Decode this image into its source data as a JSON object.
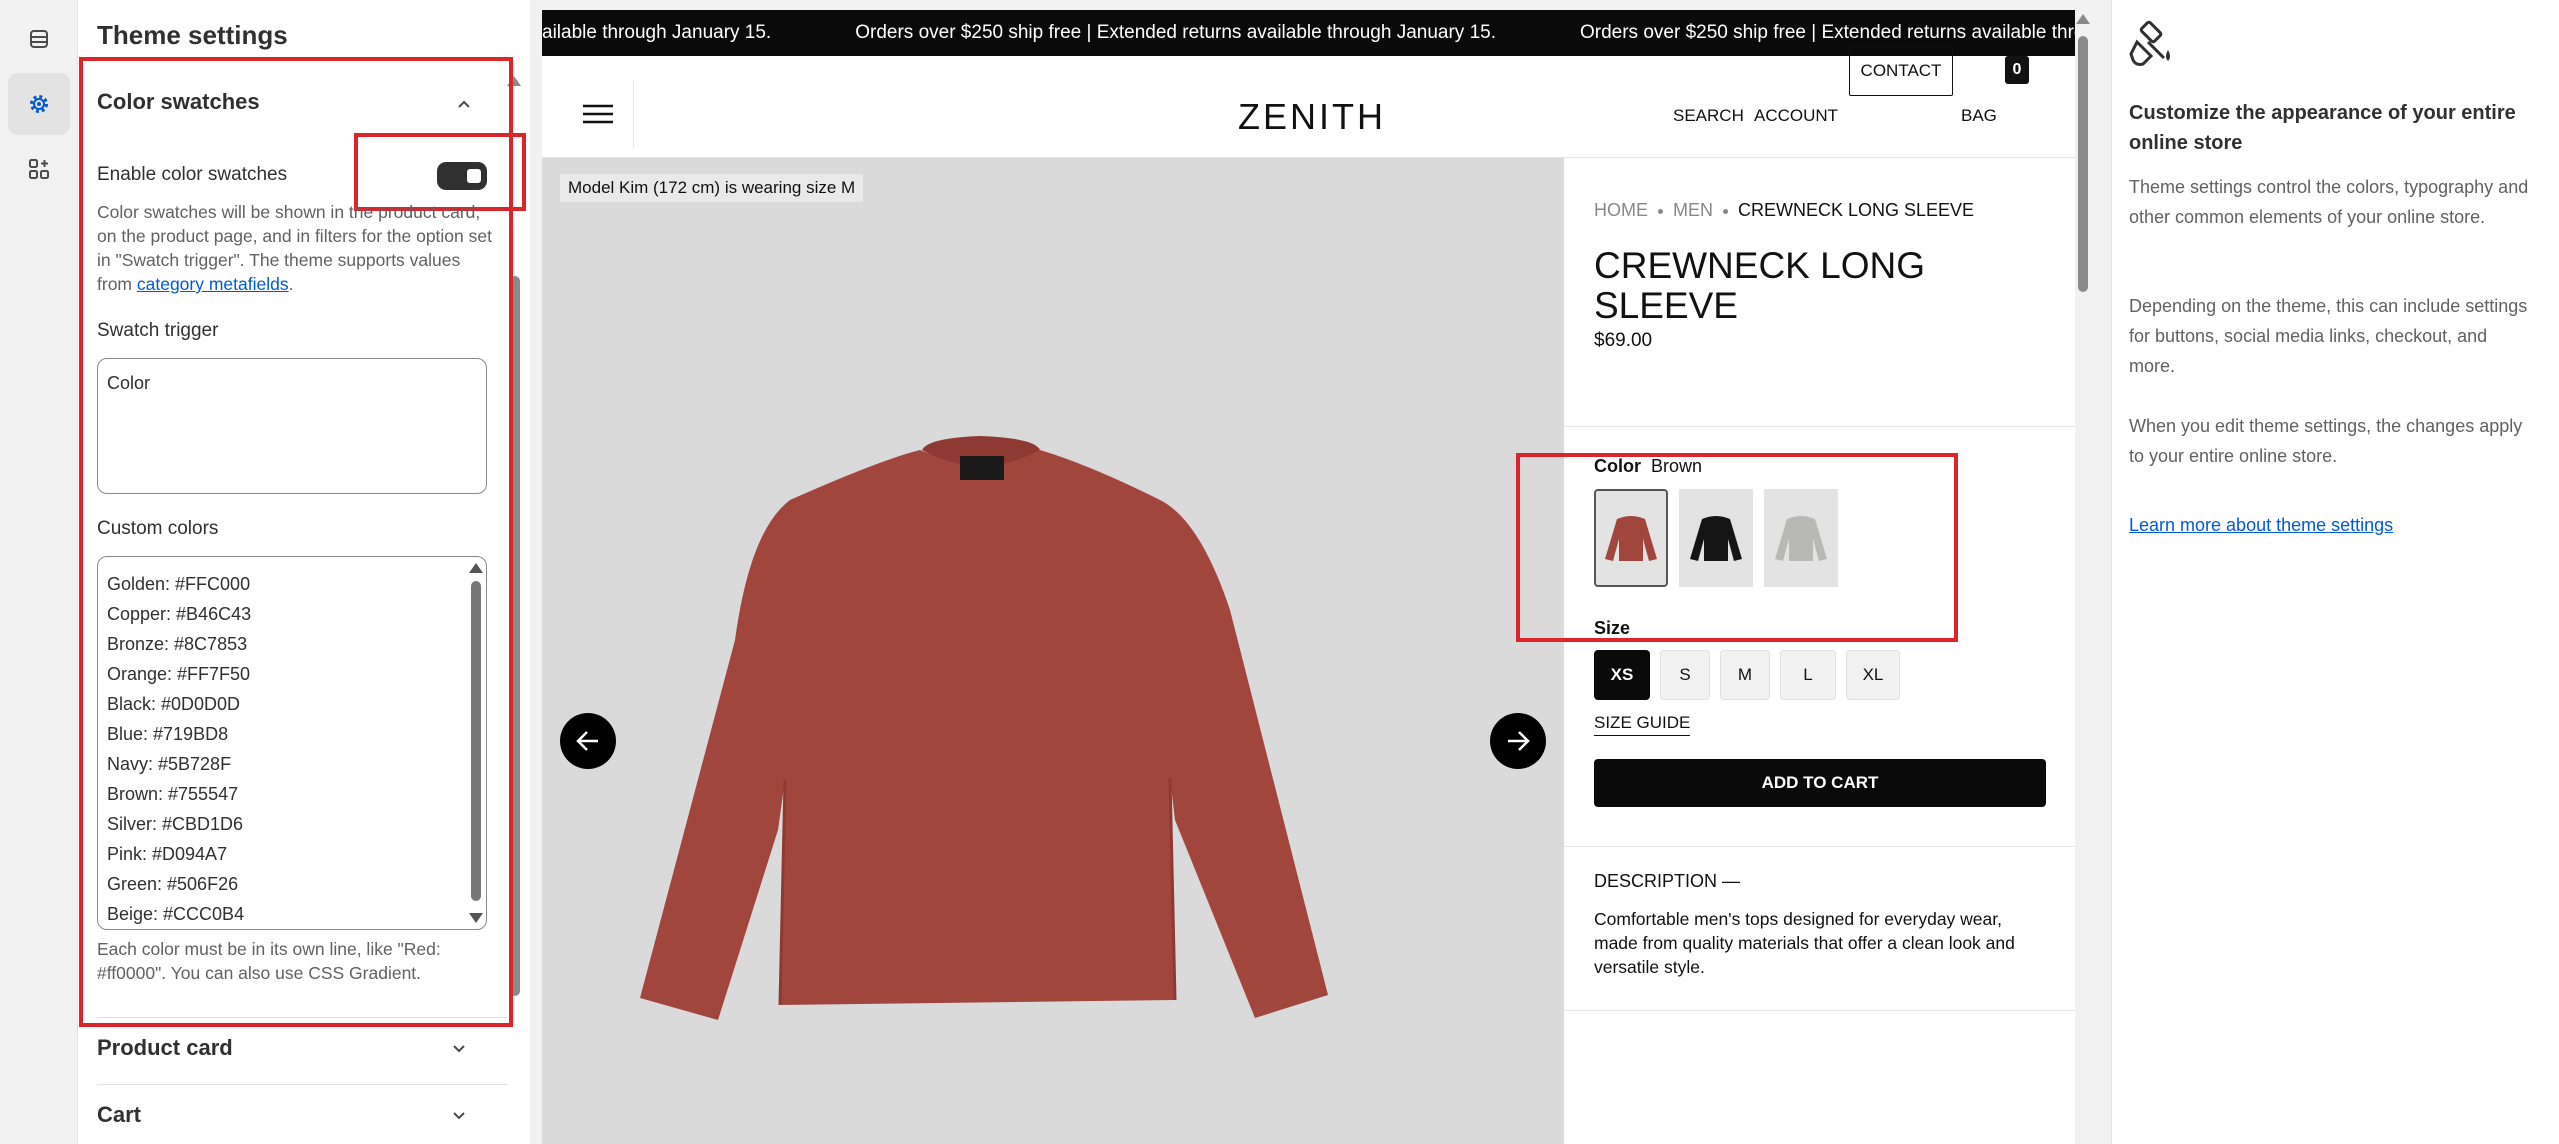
{
  "settings": {
    "title": "Theme settings",
    "section_title": "Color swatches",
    "enable_label": "Enable color swatches",
    "enable_value": true,
    "help_text": "Color swatches will be shown in the product card, on the product page, and in filters for the option set in \"Swatch trigger\". The theme supports values from ",
    "help_link": "category metafields",
    "help_end": ".",
    "swatch_trigger_label": "Swatch trigger",
    "swatch_trigger_value": "Color",
    "custom_colors_label": "Custom colors",
    "custom_colors": [
      "Golden: #FFC000",
      "Copper: #B46C43",
      "Bronze: #8C7853",
      "Orange: #FF7F50",
      "Black: #0D0D0D",
      "Blue: #719BD8",
      "Navy: #5B728F",
      "Brown: #755547",
      "Silver: #CBD1D6",
      "Pink: #D094A7",
      "Green: #506F26",
      "Beige: #CCC0B4"
    ],
    "custom_colors_note": "Each color must be in its own line, like \"Red: #ff0000\". You can also use CSS Gradient.",
    "collapsed_sections": [
      "Product card",
      "Cart"
    ]
  },
  "store": {
    "announcement": "Orders over $250 ship free | Extended returns available through January 15.",
    "announcement_lead": "ailable through January 15.",
    "logo": "ZENITH",
    "nav": {
      "search": "SEARCH",
      "account": "ACCOUNT",
      "contact": "CONTACT",
      "bag": "BAG",
      "bag_count": "0"
    },
    "model_note": "Model Kim (172 cm) is wearing size M",
    "breadcrumb": [
      "HOME",
      "MEN",
      "CREWNECK LONG SLEEVE"
    ],
    "product_title": "CREWNECK LONG SLEEVE",
    "price": "$69.00",
    "color_label": "Color",
    "color_value": "Brown",
    "swatches": [
      "brown",
      "black",
      "gray"
    ],
    "size_label": "Size",
    "sizes": [
      "XS",
      "S",
      "M",
      "L",
      "XL"
    ],
    "selected_size": "XS",
    "size_guide": "SIZE GUIDE",
    "add_to_cart": "ADD TO CART",
    "description_heading": "DESCRIPTION —",
    "description": "Comfortable men's tops designed for everyday wear, made from quality materials that offer a clean look and versatile style."
  },
  "info": {
    "heading": "Customize the appearance of your entire online store",
    "p1": "Theme settings control the colors, typography and other common elements of your online store.",
    "p2": "Depending on the theme, this can include settings for buttons, social media links, checkout, and more.",
    "p3": "When you edit theme settings, the changes apply to your entire online store.",
    "link": "Learn more about theme settings"
  },
  "colors": {
    "highlight": "#d9262b",
    "product": "#a1463d",
    "link": "#005bd3"
  },
  "icons": {
    "rail": [
      "sections-icon",
      "gear-icon",
      "apps-icon"
    ],
    "info": "paint-brush-icon"
  }
}
